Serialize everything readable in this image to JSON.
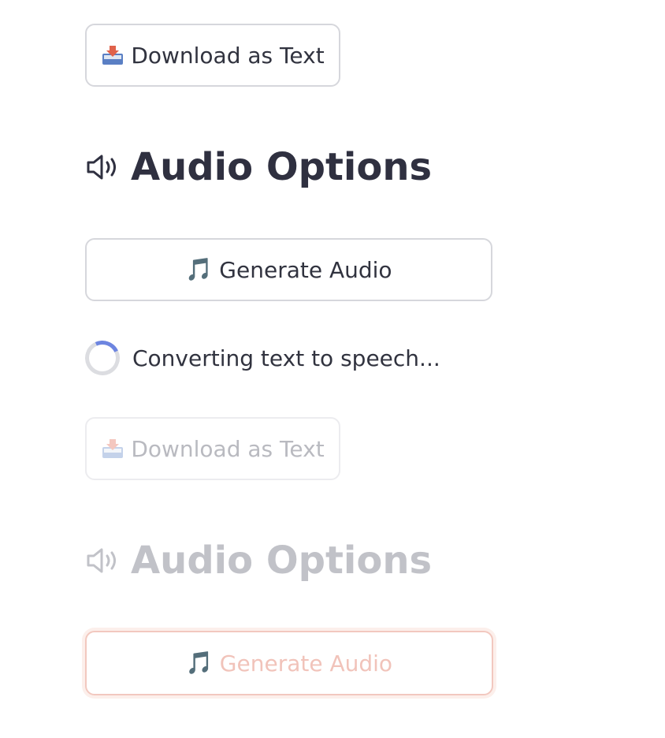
{
  "download_button": {
    "icon": "inbox-tray-icon",
    "label": "Download as Text"
  },
  "audio_heading": {
    "icon": "speaker-icon",
    "title": "Audio Options"
  },
  "generate_button": {
    "icon": "musical-note-icon",
    "glyph": "🎵",
    "label": "Generate Audio"
  },
  "status": {
    "text": "Converting text to speech..."
  },
  "faded_download_button": {
    "icon": "inbox-tray-icon",
    "label": "Download as Text"
  },
  "faded_audio_heading": {
    "icon": "speaker-icon",
    "title": "Audio Options"
  },
  "faded_generate_button": {
    "icon": "musical-note-icon",
    "glyph": "🎵",
    "label": "Generate Audio"
  },
  "colors": {
    "text": "#31333f",
    "border": "#d6d7dc",
    "spinner_accent": "#6d85e0",
    "faded_text": "#c1c2c8",
    "faded_accent": "#f1c3ba"
  }
}
